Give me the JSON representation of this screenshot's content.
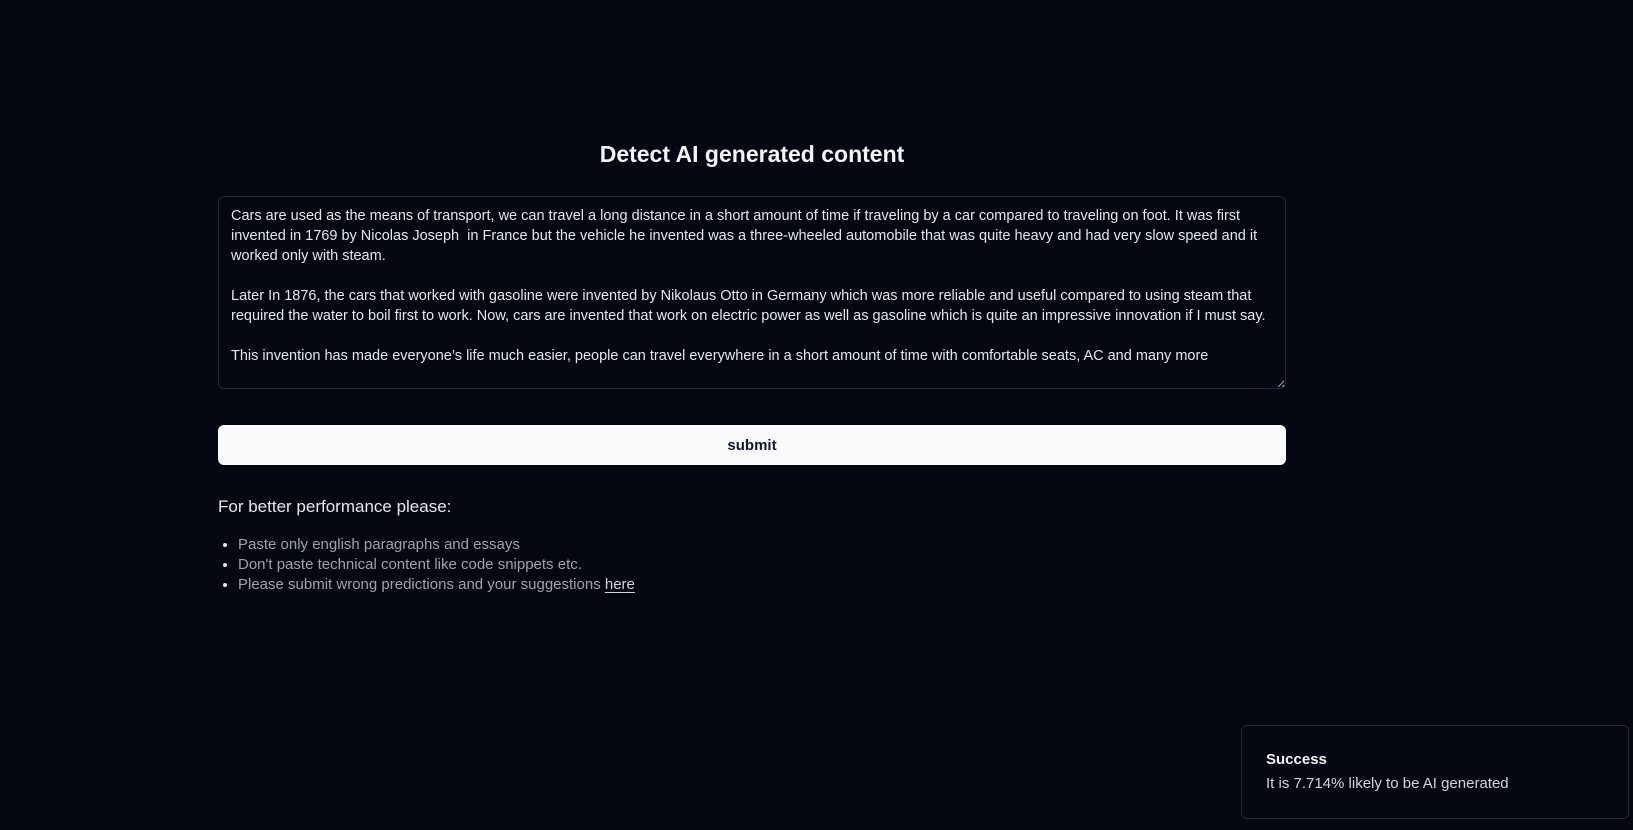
{
  "header": {
    "title": "Detect AI generated content"
  },
  "form": {
    "text_value": "Cars are used as the means of transport, we can travel a long distance in a short amount of time if traveling by a car compared to traveling on foot. It was first invented in 1769 by Nicolas Joseph  in France but the vehicle he invented was a three-wheeled automobile that was quite heavy and had very slow speed and it worked only with steam.\n\nLater In 1876, the cars that worked with gasoline were invented by Nikolaus Otto in Germany which was more reliable and useful compared to using steam that required the water to boil first to work. Now, cars are invented that work on electric power as well as gasoline which is quite an impressive innovation if I must say.\n\nThis invention has made everyone’s life much easier, people can travel everywhere in a short amount of time with comfortable seats, AC and many more",
    "submit_label": "submit"
  },
  "tips": {
    "heading": "For better performance please:",
    "items": [
      "Paste only english paragraphs and essays",
      "Don't paste technical content like code snippets etc.",
      "Please submit wrong predictions and your suggestions "
    ],
    "link_label": "here"
  },
  "toast": {
    "title": "Success",
    "message": "It is 7.714% likely to be AI generated"
  }
}
